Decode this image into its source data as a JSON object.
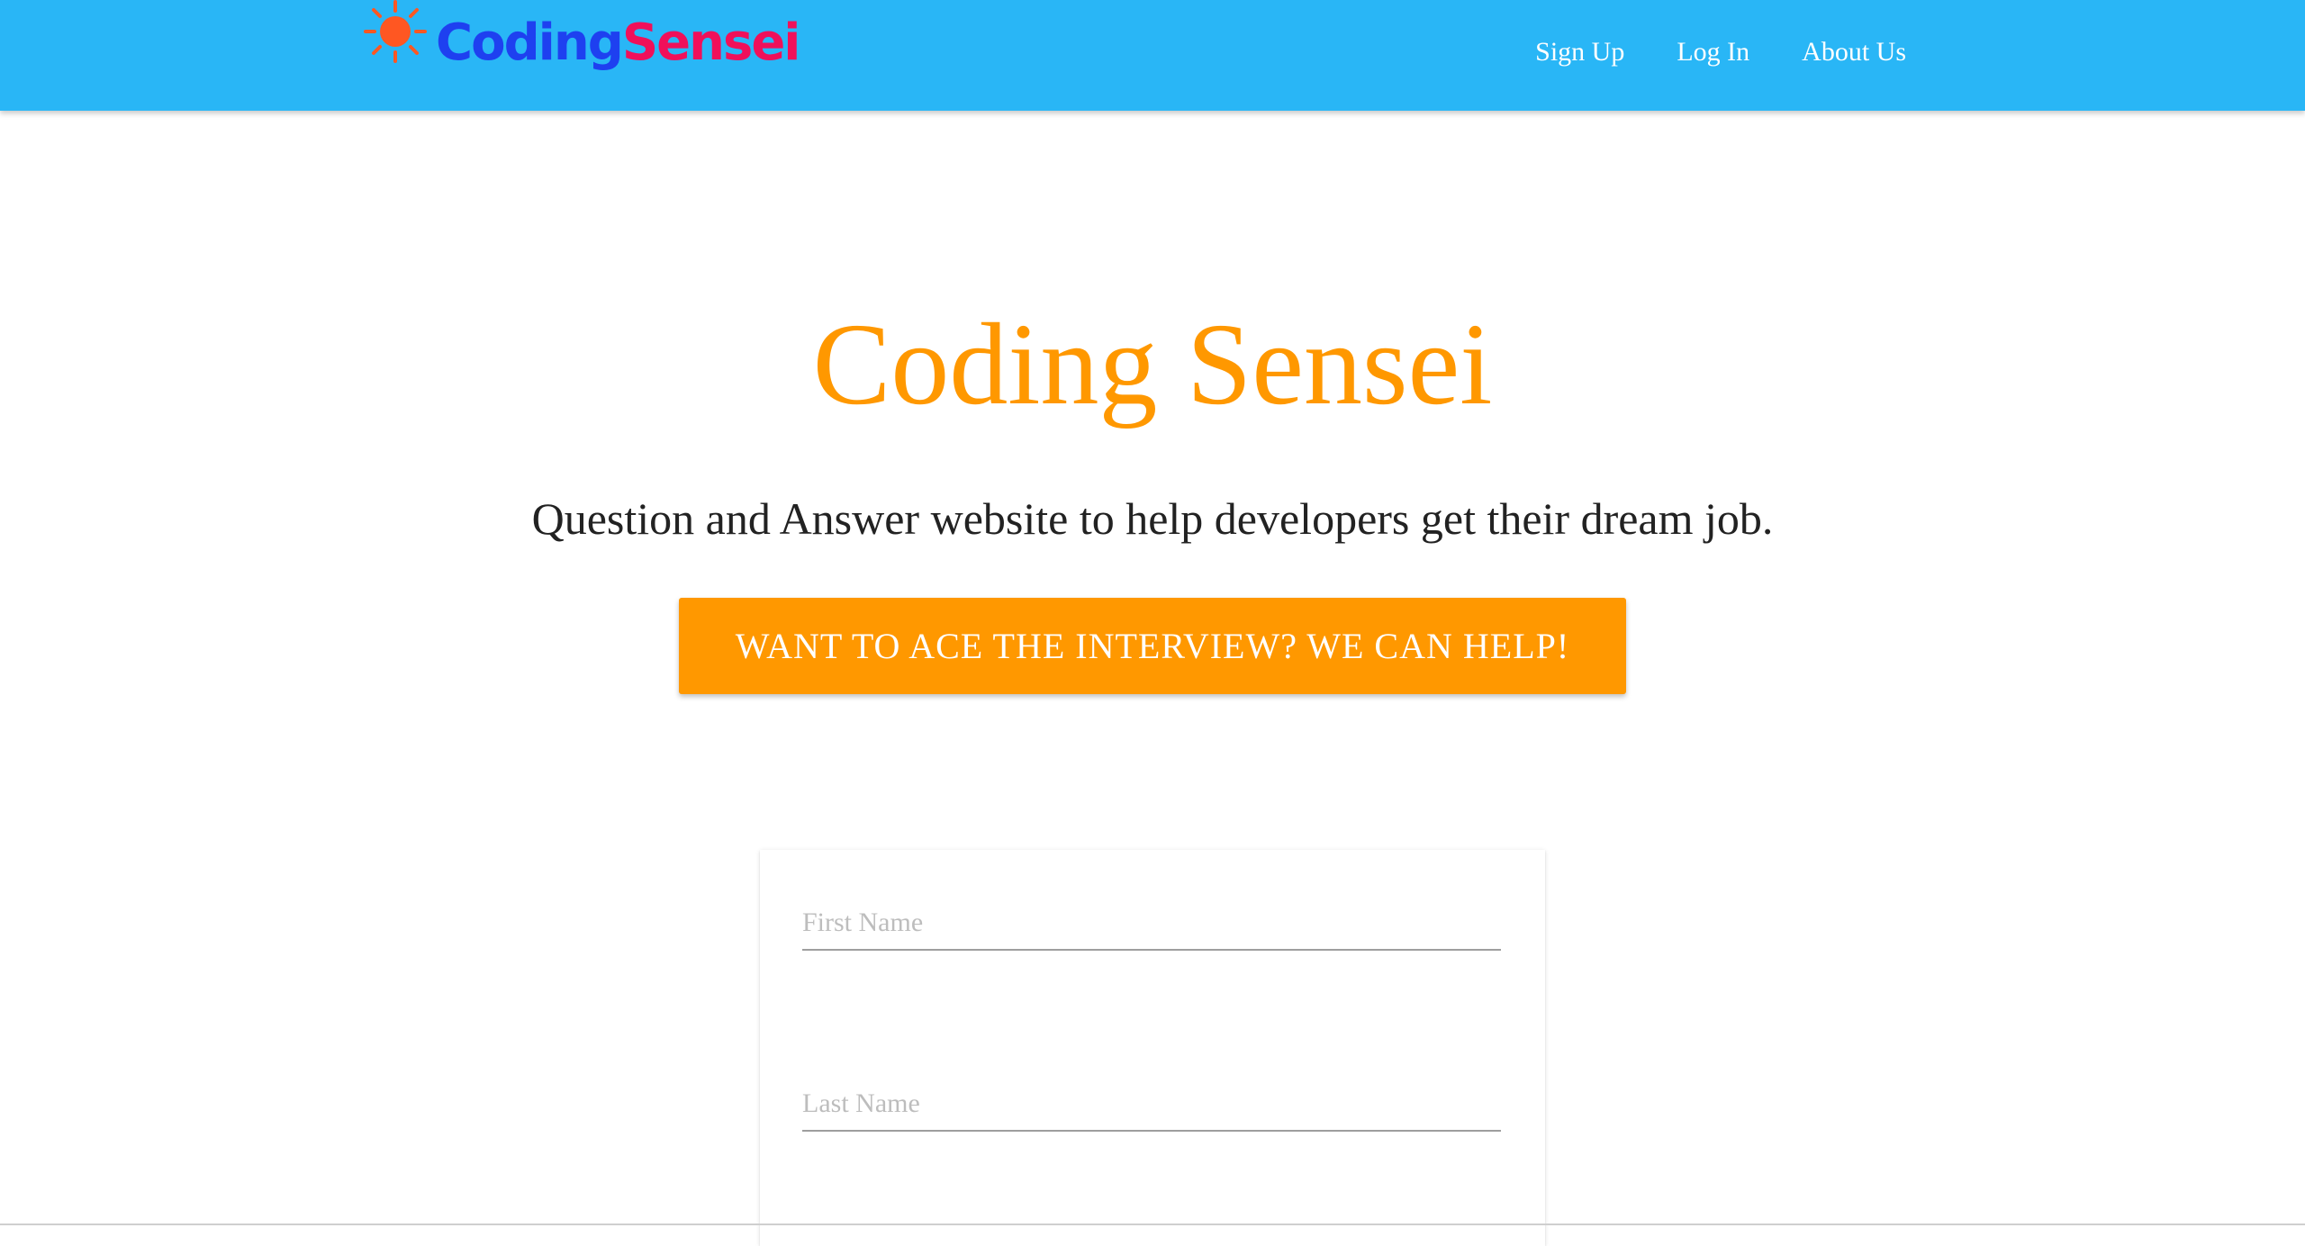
{
  "navbar": {
    "logo": {
      "part1": "Coding",
      "part2": "Sensei",
      "sun_icon": "sun-icon",
      "colors": {
        "coding": "#1e40f0",
        "sensei": "#f0105a",
        "sun": "#ff5722"
      }
    },
    "links": [
      {
        "label": "Sign Up"
      },
      {
        "label": "Log In"
      },
      {
        "label": "About Us"
      }
    ],
    "background_color": "#29b6f6"
  },
  "hero": {
    "title": "Coding Sensei",
    "subtitle": "Question and Answer website to help developers get their dream job.",
    "cta_label": "WANT TO ACE THE INTERVIEW? WE CAN HELP!",
    "accent_color": "#ff9800"
  },
  "signup_form": {
    "first_name": {
      "placeholder": "First Name",
      "value": ""
    },
    "last_name": {
      "placeholder": "Last Name",
      "value": ""
    }
  }
}
